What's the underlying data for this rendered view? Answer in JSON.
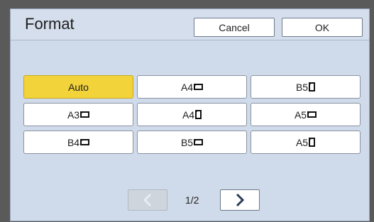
{
  "dialog": {
    "title": "Format",
    "cancel_label": "Cancel",
    "ok_label": "OK"
  },
  "options": [
    {
      "label": "Auto",
      "orientation": "none",
      "selected": true
    },
    {
      "label": "A4",
      "orientation": "landscape",
      "selected": false
    },
    {
      "label": "B5",
      "orientation": "portrait",
      "selected": false
    },
    {
      "label": "A3",
      "orientation": "landscape",
      "selected": false
    },
    {
      "label": "A4",
      "orientation": "portrait",
      "selected": false
    },
    {
      "label": "A5",
      "orientation": "landscape",
      "selected": false
    },
    {
      "label": "B4",
      "orientation": "landscape",
      "selected": false
    },
    {
      "label": "B5",
      "orientation": "landscape",
      "selected": false
    },
    {
      "label": "A5",
      "orientation": "portrait",
      "selected": false
    }
  ],
  "pager": {
    "indicator": "1/2",
    "prev_icon": "chevron-left-icon",
    "next_icon": "chevron-right-icon"
  },
  "colors": {
    "selected": "#f2d33a",
    "panel": "#cfdaea"
  }
}
